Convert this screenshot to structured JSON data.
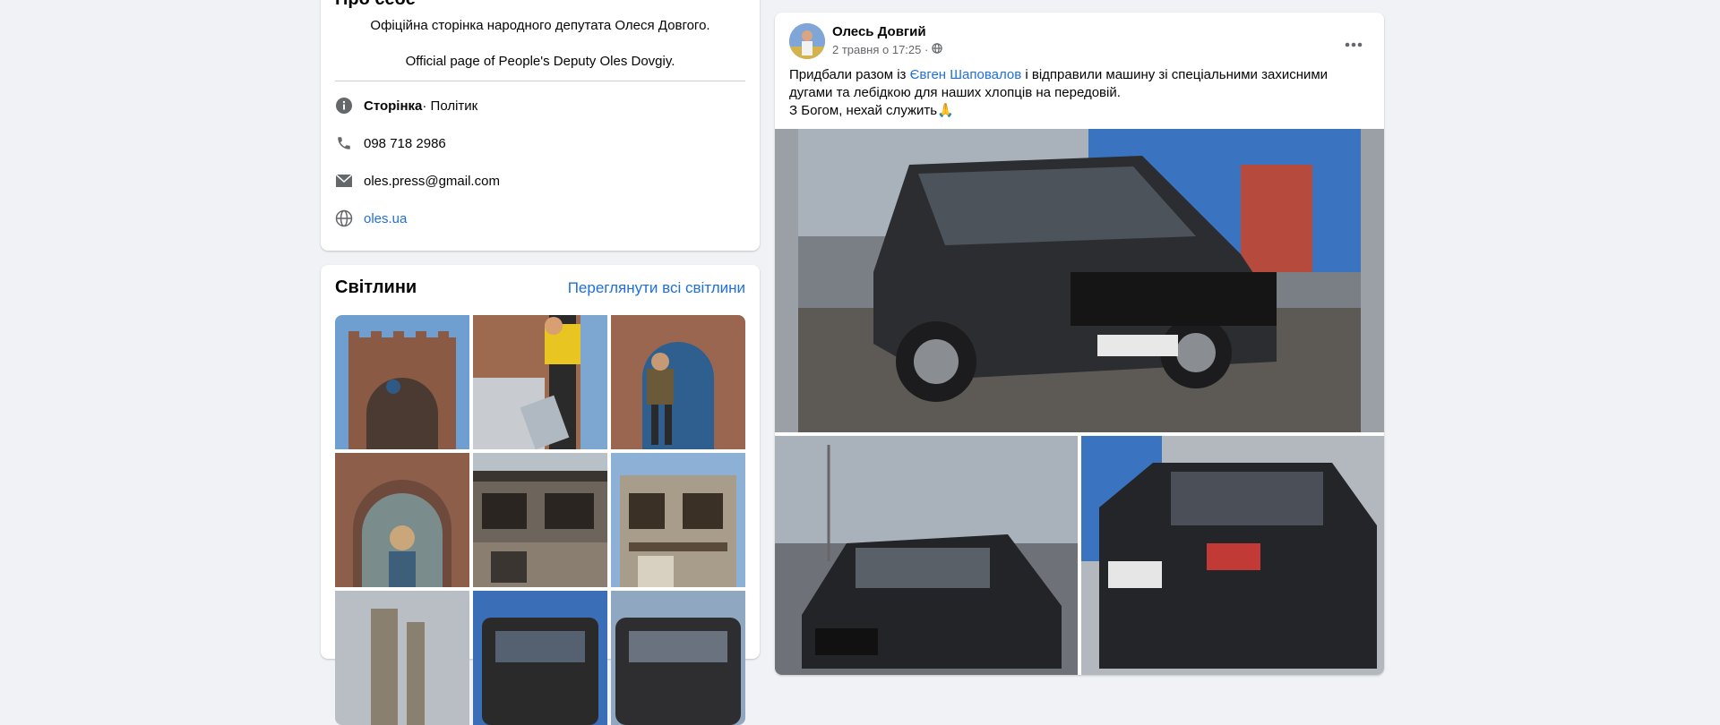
{
  "about": {
    "title": "Про себе",
    "bio_uk": "Офіційна сторінка народного депутата Олеся Довгого.",
    "bio_en": "Official page of People's Deputy Oles Dovgiy.",
    "category_strong": "Сторінка",
    "category_rest": " · Політик",
    "phone": "098 718 2986",
    "email": "oles.press@gmail.com",
    "website": "oles.ua"
  },
  "photos": {
    "title": "Світлини",
    "see_all": "Переглянути всі світлини"
  },
  "post": {
    "author": "Олесь Довгий",
    "time": "2 травня о 17:25 ·",
    "text_before": "Придбали разом із ",
    "mention": "Євген Шаповалов",
    "text_after": " і відправили машину зі спеціальними захисними дугами та лебідкою для наших хлопців на передовій.",
    "text_line2": "З Богом, нехай служить🙏"
  },
  "colors": {
    "background": "#f0f2f5",
    "link": "#216fdb",
    "secondary_text": "#65676b",
    "icon": "#65676b"
  }
}
